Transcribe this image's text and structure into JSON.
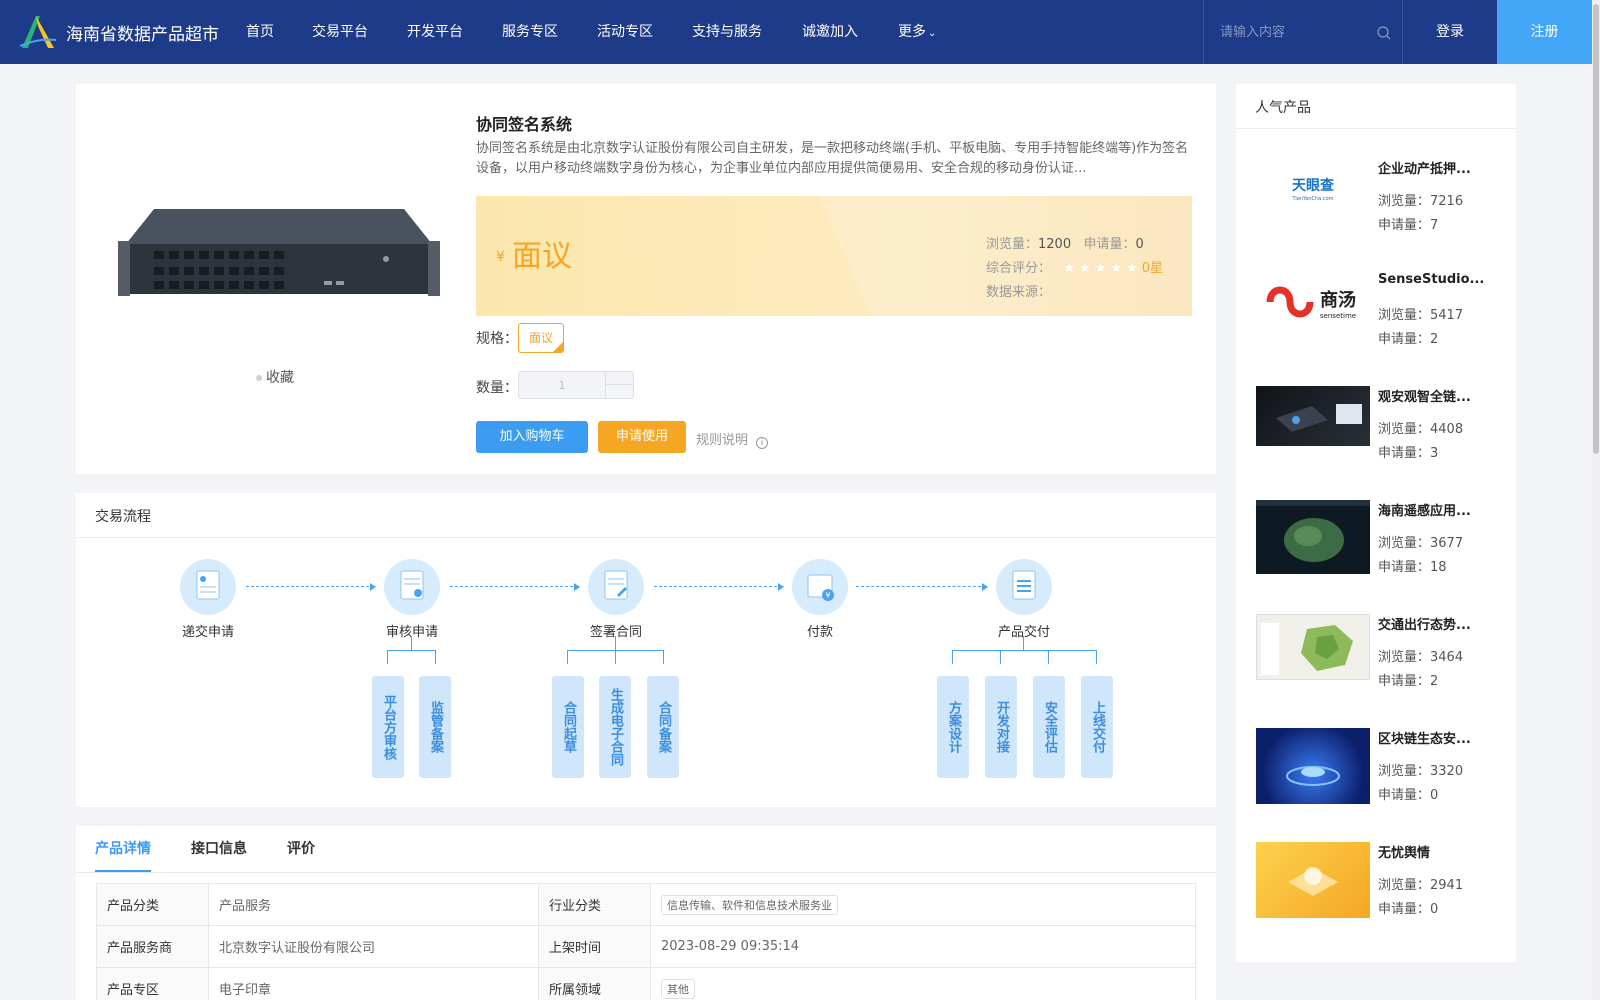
{
  "header": {
    "site_title": "海南省数据产品超市",
    "nav": [
      "首页",
      "交易平台",
      "开发平台",
      "服务专区",
      "活动专区",
      "支持与服务",
      "诚邀加入",
      "更多"
    ],
    "search_placeholder": "请输入内容",
    "login": "登录",
    "register": "注册"
  },
  "product": {
    "title": "协同签名系统",
    "description": "协同签名系统是由北京数字认证股份有限公司自主研发，是一款把移动终端(手机、平板电脑、专用手持智能终端等)作为签名设备，以用户移动终端数字身份为核心，为企事业单位内部应用提供简便易用、安全合规的移动身份认证...",
    "favorite": "收藏",
    "price_symbol": "¥",
    "price": "面议",
    "views_label": "浏览量：",
    "views": "1200",
    "applies_label": "申请量：",
    "applies": "0",
    "rating_label": "综合评分：",
    "rating_stars": 0,
    "rating_text": "0星",
    "source_label": "数据来源：",
    "spec_label": "规格：",
    "spec_value": "面议",
    "quantity_label": "数量：",
    "quantity_value": "1",
    "add_to_cart": "加入购物车",
    "apply_use": "申请使用",
    "rules": "规则说明"
  },
  "process": {
    "title": "交易流程",
    "steps": [
      "递交申请",
      "审核申请",
      "签署合同",
      "付款",
      "产品交付"
    ],
    "substeps": {
      "review": [
        "平台方审核",
        "监管备案"
      ],
      "contract": [
        "合同起草",
        "生成电子合同",
        "合同备案"
      ],
      "delivery": [
        "方案设计",
        "开发对接",
        "安全评估",
        "上线交付"
      ]
    }
  },
  "tabs": [
    "产品详情",
    "接口信息",
    "评价"
  ],
  "details": [
    {
      "k1": "产品分类",
      "v1": "产品服务",
      "k2": "行业分类",
      "v2": "信息传输、软件和信息技术服务业"
    },
    {
      "k1": "产品服务商",
      "v1": "北京数字认证股份有限公司",
      "k2": "上架时间",
      "v2": "2023-08-29 09:35:14"
    },
    {
      "k1": "产品专区",
      "v1": "电子印章",
      "k2": "所属领域",
      "v2": "其他"
    }
  ],
  "popular": {
    "title": "人气产品",
    "views_label": "浏览量：",
    "applies_label": "申请量：",
    "logo_tianyancha": "天眼查",
    "logo_tianyancha_sub": "TianYanCha.com",
    "logo_sensetime": "商汤",
    "logo_sensetime_sub": "sensetime",
    "items": [
      {
        "name": "企业动产抵押...",
        "views": "7216",
        "applies": "7"
      },
      {
        "name": "SenseStudio...",
        "views": "5417",
        "applies": "2"
      },
      {
        "name": "观安观智全链...",
        "views": "4408",
        "applies": "3"
      },
      {
        "name": "海南遥感应用...",
        "views": "3677",
        "applies": "18"
      },
      {
        "name": "交通出行态势...",
        "views": "3464",
        "applies": "2"
      },
      {
        "name": "区块链生态安...",
        "views": "3320",
        "applies": "0"
      },
      {
        "name": "无忧舆情",
        "views": "2941",
        "applies": "0"
      }
    ]
  },
  "colors": {
    "header_bg": "#1e3b8a",
    "accent_blue": "#3c9cf2",
    "accent_orange": "#f5a623"
  }
}
